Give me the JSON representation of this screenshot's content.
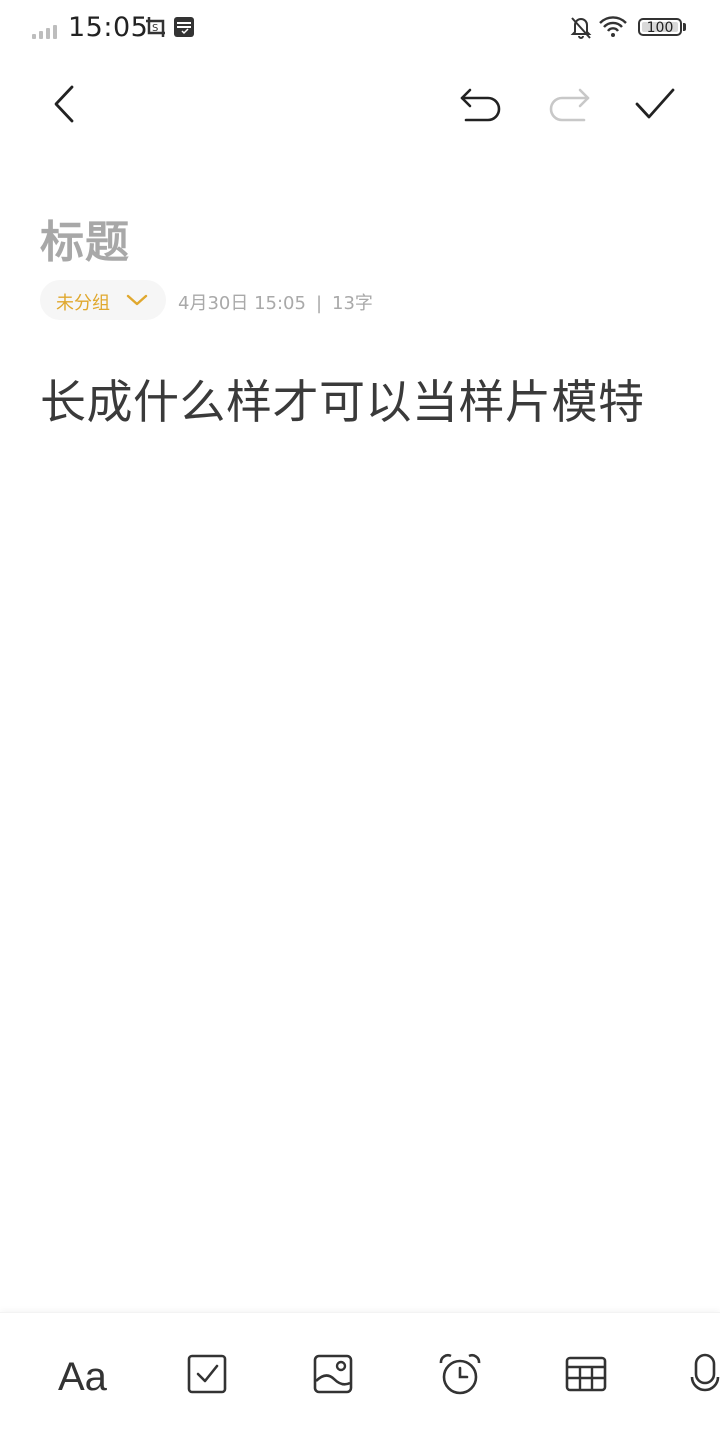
{
  "status_bar": {
    "time": "15:05",
    "battery": "100",
    "icons": [
      "signal-icon",
      "screenshot-icon",
      "sim-icon",
      "mute-bell-icon",
      "wifi-icon",
      "battery-icon"
    ]
  },
  "nav": {
    "icons": [
      "back-icon",
      "undo-icon",
      "redo-icon",
      "confirm-icon"
    ],
    "redo_disabled": true
  },
  "note": {
    "title_placeholder": "标题",
    "group_label": "未分组",
    "date": "4月30日 15:05",
    "separator": "|",
    "word_count": "13字",
    "body": "长成什么样才可以当样片模特"
  },
  "toolbar": {
    "text_format_label": "Aa",
    "icons": [
      "text-format-icon",
      "checklist-icon",
      "image-icon",
      "alarm-icon",
      "table-icon",
      "microphone-icon"
    ]
  },
  "colors": {
    "accent": "#e0a82e",
    "placeholder": "#a8a8a8",
    "meta_text": "#a9a9a9",
    "body_text": "#3a3a3a",
    "disabled_icon": "#c8c8c8"
  }
}
